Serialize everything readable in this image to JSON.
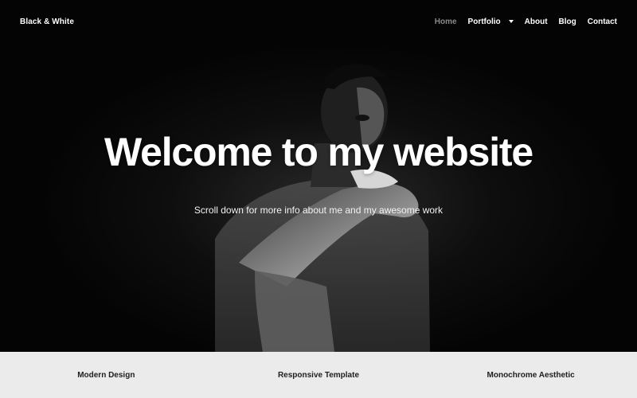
{
  "header": {
    "brand": "Black & White",
    "nav": [
      {
        "label": "Home",
        "active": true
      },
      {
        "label": "Portfolio",
        "dropdown": true
      },
      {
        "label": "About"
      },
      {
        "label": "Blog"
      },
      {
        "label": "Contact"
      }
    ]
  },
  "hero": {
    "title": "Welcome to my website",
    "subtitle": "Scroll down for more info about me and my awesome work",
    "image_icon": "man-portrait-monochrome"
  },
  "features": [
    {
      "label": "Modern Design"
    },
    {
      "label": "Responsive Template"
    },
    {
      "label": "Monochrome Aesthetic"
    }
  ],
  "colors": {
    "hero_background": "#050505",
    "text": "#ffffff",
    "nav_active": "#8a8a8a",
    "feature_bar": "#ebebeb"
  }
}
